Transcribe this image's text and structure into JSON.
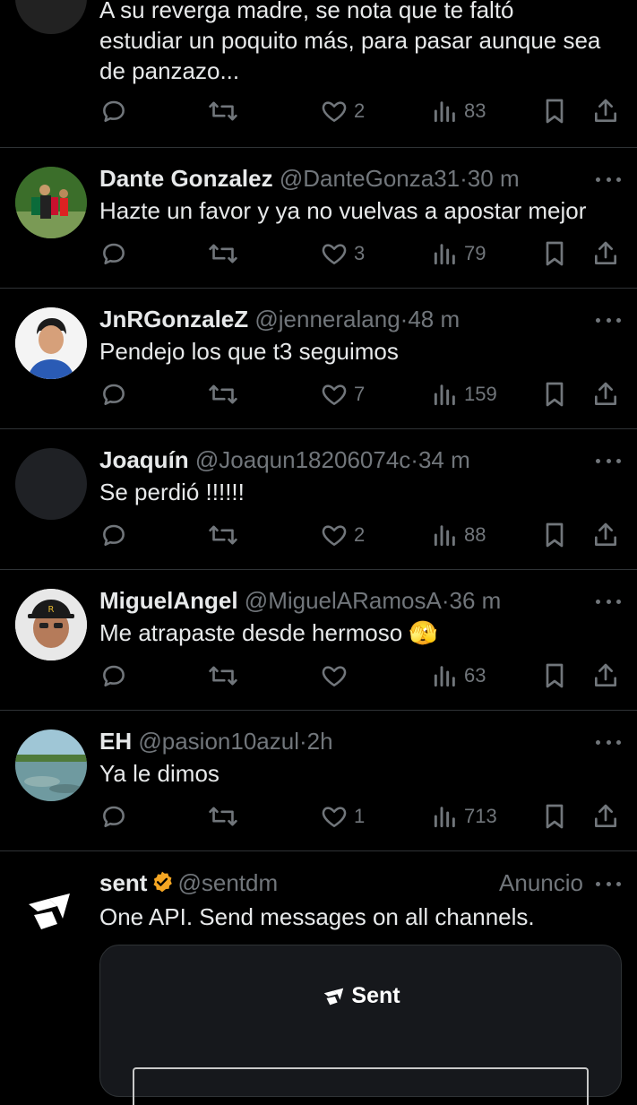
{
  "colors": {
    "background": "#000000",
    "text": "#e7e9ea",
    "muted": "#71767b",
    "divider": "#2f3336",
    "verified": "#f5a623"
  },
  "top_tweet": {
    "text_line1": "A su reverga madre, se nota que te faltó",
    "text_line2": "estudiar un poquito más, para pasar aunque sea",
    "text_line3": "de panzazo...",
    "likes": "2",
    "views": "83"
  },
  "replies": [
    {
      "name": "Dante Gonzalez",
      "handle": "@DanteGonza31",
      "dot": "·",
      "time": "30 m",
      "text": "Hazte un favor y ya no vuelvas a apostar mejor",
      "likes": "3",
      "views": "79"
    },
    {
      "name": "JnRGonzaleZ",
      "handle": "@jenneralang",
      "dot": "·",
      "time": "48 m",
      "text": "Pendejo los que t3 seguimos",
      "likes": "7",
      "views": "159"
    },
    {
      "name": "Joaquín",
      "handle": "@Joaqun18206074c",
      "dot": "·",
      "time": "34 m",
      "text": "Se perdió !!!!!!",
      "likes": "2",
      "views": "88"
    },
    {
      "name": "MiguelAngel",
      "handle": "@MiguelARamosA",
      "dot": "·",
      "time": "36 m",
      "text": "Me atrapaste desde hermoso 🫣",
      "likes": "",
      "views": "63"
    },
    {
      "name": "EH",
      "handle": "@pasion10azul",
      "dot": "·",
      "time": "2h",
      "text": "Ya le dimos",
      "likes": "1",
      "views": "713"
    }
  ],
  "ad": {
    "name": "sent",
    "handle": "@sentdm",
    "label": "Anuncio",
    "text": "One API. Send messages on all channels.",
    "card_brand": "Sent"
  },
  "icons": [
    "reply-icon",
    "retweet-icon",
    "like-icon",
    "views-icon",
    "bookmark-icon",
    "share-icon",
    "more-icon",
    "verified-icon"
  ]
}
